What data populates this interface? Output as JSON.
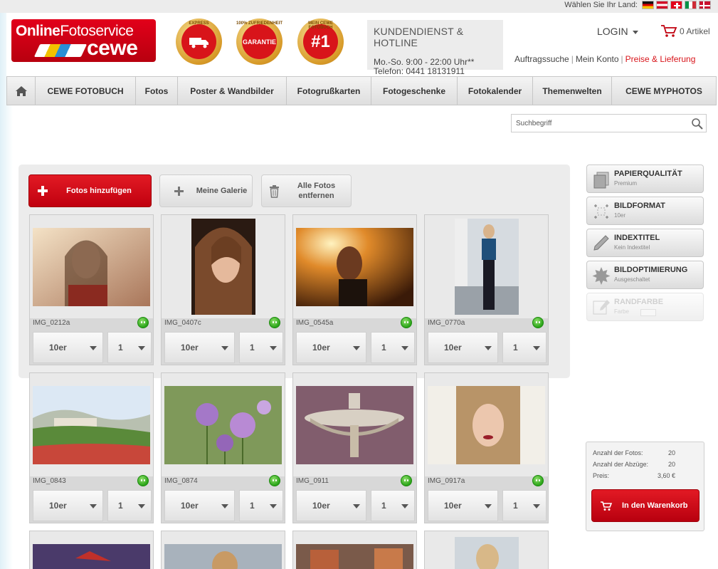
{
  "topbar": {
    "country_label": "Wählen Sie Ihr Land:",
    "flags": [
      "flag-de-icon",
      "flag-at-icon",
      "flag-ch-icon",
      "flag-it-icon",
      "flag-dk-icon"
    ]
  },
  "logo": {
    "line1_bold": "Online",
    "line1_rest": "Fotoservice",
    "line2": "cewe"
  },
  "badges": {
    "express": {
      "ring": "EXPRESS",
      "center": "SERVICE"
    },
    "garantie": {
      "ring": "100% ZUFRIEDENHEIT",
      "center": "GARANTIE"
    },
    "one": {
      "ring": "MEIN CEWE FOTOBUCH",
      "center": "#1"
    }
  },
  "hotline": {
    "title": "KUNDENDIENST & HOTLINE",
    "hours": "Mo.-So. 9:00 - 22:00 Uhr**",
    "phone": "Telefon: 0441 18131911"
  },
  "account": {
    "login": "LOGIN",
    "cart": "0 Artikel",
    "links": [
      "Auftragssuche",
      "Mein Konto",
      "Preise & Lieferung"
    ]
  },
  "nav": {
    "items": [
      "CEWE FOTOBUCH",
      "Fotos",
      "Poster & Wandbilder",
      "Fotogrußkarten",
      "Fotogeschenke",
      "Fotokalender",
      "Themenwelten",
      "CEWE MYPHOTOS"
    ]
  },
  "search": {
    "placeholder": "Suchbegriff"
  },
  "toolbar": {
    "add": "Fotos hinzufügen",
    "gallery": "Meine Galerie",
    "delete": "Alle Fotos\nentfernen"
  },
  "photos": [
    {
      "name": "IMG_0212a",
      "format": "10er",
      "qty": "1"
    },
    {
      "name": "IMG_0407c",
      "format": "10er",
      "qty": "1"
    },
    {
      "name": "IMG_0545a",
      "format": "10er",
      "qty": "1"
    },
    {
      "name": "IMG_0770a",
      "format": "10er",
      "qty": "1"
    },
    {
      "name": "IMG_0843",
      "format": "10er",
      "qty": "1"
    },
    {
      "name": "IMG_0874",
      "format": "10er",
      "qty": "1"
    },
    {
      "name": "IMG_0911",
      "format": "10er",
      "qty": "1"
    },
    {
      "name": "IMG_0917a",
      "format": "10er",
      "qty": "1"
    }
  ],
  "options": [
    {
      "title": "PAPIERQUALITÄT",
      "sub": "Premium",
      "icon": "paper-icon"
    },
    {
      "title": "BILDFORMAT",
      "sub": "10er",
      "icon": "crop-icon"
    },
    {
      "title": "INDEXTITEL",
      "sub": "Kein Indextitel",
      "icon": "pen-icon"
    },
    {
      "title": "BILDOPTIMIERUNG",
      "sub": "Ausgeschaltet",
      "icon": "optimize-icon"
    },
    {
      "title": "RANDFARBE",
      "sub": "Farbe",
      "icon": "border-color-icon"
    }
  ],
  "summary": {
    "photos_label": "Anzahl der Fotos:",
    "photos_value": "20",
    "prints_label": "Anzahl der Abzüge:",
    "prints_value": "20",
    "price_label": "Preis:",
    "price_value": "3,60 €",
    "cart_button": "In den Warenkorb"
  },
  "colors": {
    "brand_red": "#d8141a",
    "ok_green": "#2aa418"
  }
}
